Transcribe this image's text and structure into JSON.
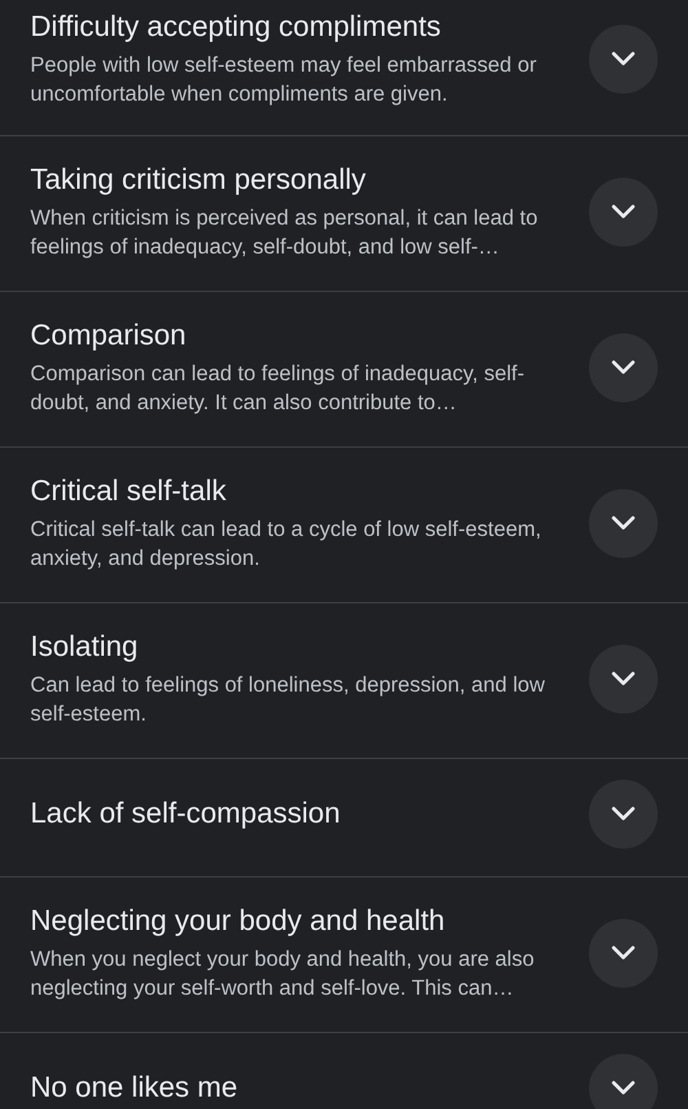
{
  "items": [
    {
      "title": "Difficulty accepting compliments",
      "description": "People with low self-esteem may feel embarrassed or uncomfortable when compliments are given.",
      "expanded": false
    },
    {
      "title": "Taking criticism personally",
      "description": "When criticism is perceived as personal, it can lead to feelings of inadequacy, self-doubt, and low self-…",
      "expanded": false
    },
    {
      "title": "Comparison",
      "description": "Comparison can lead to feelings of inadequacy, self-doubt, and anxiety. It can also contribute to…",
      "expanded": false
    },
    {
      "title": "Critical self-talk",
      "description": "Critical self-talk can lead to a cycle of low self-esteem, anxiety, and depression.",
      "expanded": false
    },
    {
      "title": "Isolating",
      "description": "Can lead to feelings of loneliness, depression, and low self-esteem.",
      "expanded": false
    },
    {
      "title": "Lack of self-compassion",
      "expanded": false
    },
    {
      "title": "Neglecting your body and health",
      "description": "When you neglect your body and health, you are also neglecting your self-worth and self-love. This can…",
      "expanded": false
    },
    {
      "title": "No one likes me",
      "expanded": false
    }
  ]
}
